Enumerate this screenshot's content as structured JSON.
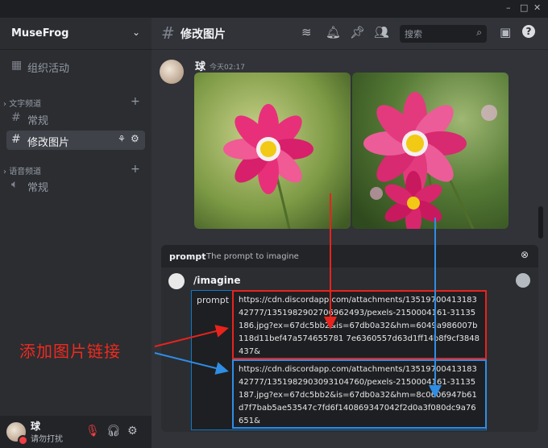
{
  "window": {
    "minimize": "–",
    "maximize": "□",
    "close": "✕"
  },
  "server": {
    "name": "MuseFrog"
  },
  "sidebar": {
    "events_label": "组织活动",
    "text_category": "文字频道",
    "voice_category": "语音频道",
    "text_channels": [
      "常规",
      "修改图片"
    ],
    "voice_channels": [
      "常规"
    ]
  },
  "user": {
    "name": "球",
    "status": "请勿打扰"
  },
  "channel": {
    "title": "修改图片"
  },
  "search": {
    "placeholder": "搜索"
  },
  "message": {
    "author": "球",
    "time": "今天02:17"
  },
  "command": {
    "option_name": "prompt",
    "option_desc": "The prompt to imagine",
    "name": "/imagine",
    "field_label": "prompt",
    "url1": "https://cdn.discordapp.com/attachments/1351970041318342777/1351982902706962493/pexels-2150004161-31135186.jpg?ex=67dc5bb2&is=67db0a32&hm=6049a986007b118d11bef47a574655781 7e6360557d63d1ff14b8f9cf3848437&",
    "url2": "https://cdn.discordapp.com/attachments/1351970041318342777/1351982903093104760/pexels-2150004161-31135187.jpg?ex=67dc5bb2&is=67db0a32&hm=8c0606947b61d7f7bab5ae53547c7fd6f140869347042f2d0a3f080dc9a76651&"
  },
  "annotation": {
    "text": "添加图片链接"
  },
  "colors": {
    "red_box": "#e8231c",
    "blue_box": "#2f8de4",
    "annotation": "#f02a1e"
  }
}
